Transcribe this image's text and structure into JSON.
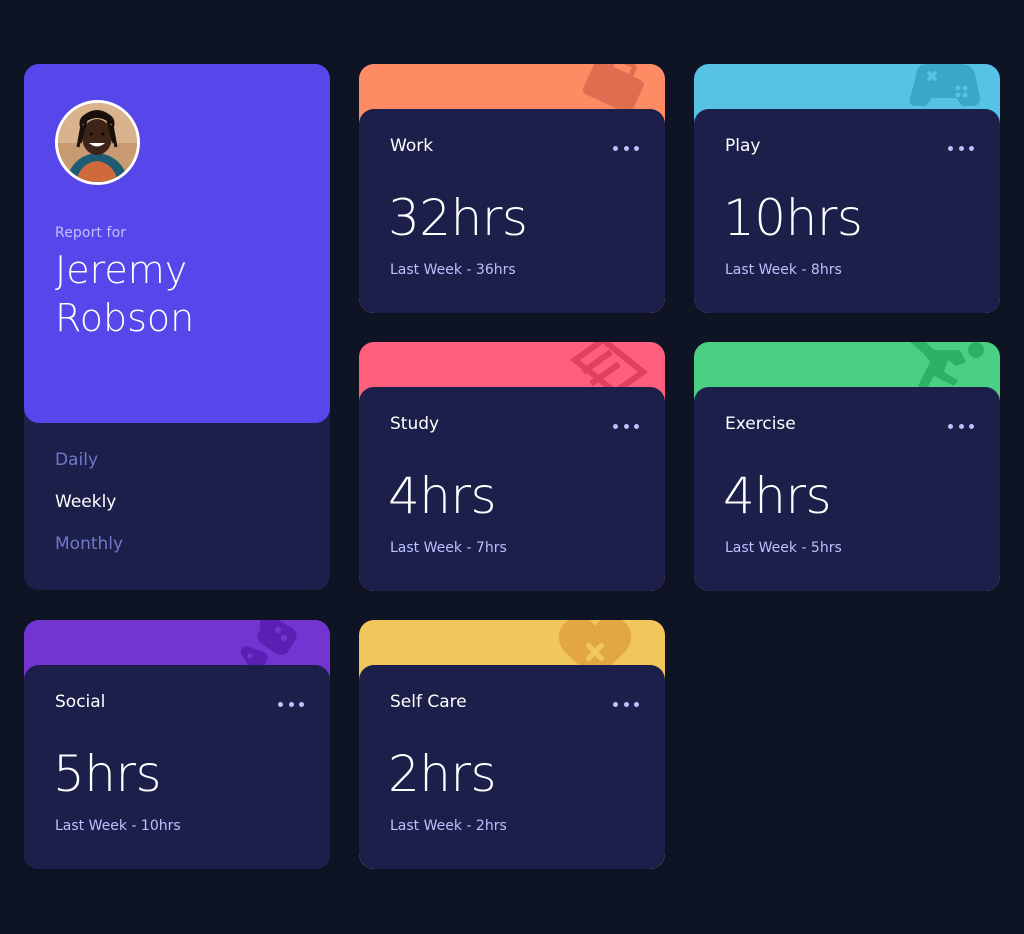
{
  "profile": {
    "report_label": "Report for",
    "name": "Jeremy Robson",
    "avatar_icon": "avatar-photo"
  },
  "timeframes": [
    {
      "label": "Daily",
      "active": false
    },
    {
      "label": "Weekly",
      "active": true
    },
    {
      "label": "Monthly",
      "active": false
    }
  ],
  "activities": [
    {
      "title": "Work",
      "hours": "32hrs",
      "previous": "Last Week - 36hrs",
      "color": "#ff8b64",
      "icon": "work-icon"
    },
    {
      "title": "Play",
      "hours": "10hrs",
      "previous": "Last Week - 8hrs",
      "color": "#55c2e6",
      "icon": "play-icon"
    },
    {
      "title": "Study",
      "hours": "4hrs",
      "previous": "Last Week - 7hrs",
      "color": "#ff5e7d",
      "icon": "study-icon"
    },
    {
      "title": "Exercise",
      "hours": "4hrs",
      "previous": "Last Week - 5hrs",
      "color": "#4bcf82",
      "icon": "exercise-icon"
    },
    {
      "title": "Social",
      "hours": "5hrs",
      "previous": "Last Week - 10hrs",
      "color": "#7335d2",
      "icon": "social-icon"
    },
    {
      "title": "Self Care",
      "hours": "2hrs",
      "previous": "Last Week - 2hrs",
      "color": "#f1c75b",
      "icon": "self-care-icon"
    }
  ],
  "colors": {
    "background": "#0f1424",
    "card": "#1c1f4a",
    "profile_accent": "#5747ea",
    "pale_blue": "#bdc1ff",
    "desaturated_blue": "#7078c9"
  }
}
